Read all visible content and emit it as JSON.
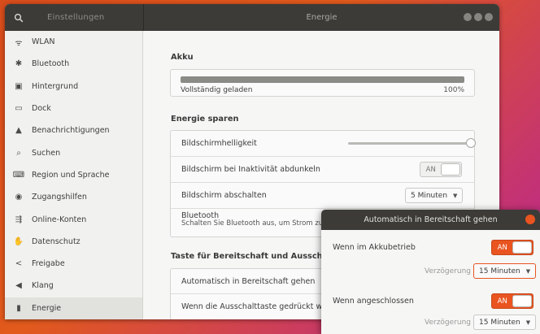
{
  "header": {
    "search_icon": "search-icon",
    "left_title": "Einstellungen",
    "title": "Energie"
  },
  "sidebar": {
    "items": [
      {
        "label": "WLAN",
        "icon": "wifi-icon",
        "glyph": "ᯤ"
      },
      {
        "label": "Bluetooth",
        "icon": "bluetooth-icon",
        "glyph": "✱"
      },
      {
        "label": "Hintergrund",
        "icon": "background-icon",
        "glyph": "▣"
      },
      {
        "label": "Dock",
        "icon": "dock-icon",
        "glyph": "▭"
      },
      {
        "label": "Benachrichtigungen",
        "icon": "bell-icon",
        "glyph": "▲"
      },
      {
        "label": "Suchen",
        "icon": "search-icon",
        "glyph": "⌕"
      },
      {
        "label": "Region und Sprache",
        "icon": "keyboard-icon",
        "glyph": "⌨"
      },
      {
        "label": "Zugangshilfen",
        "icon": "accessibility-icon",
        "glyph": "◉"
      },
      {
        "label": "Online-Konten",
        "icon": "online-accounts-icon",
        "glyph": "⇶"
      },
      {
        "label": "Datenschutz",
        "icon": "privacy-icon",
        "glyph": "✋"
      },
      {
        "label": "Freigabe",
        "icon": "share-icon",
        "glyph": "<"
      },
      {
        "label": "Klang",
        "icon": "speaker-icon",
        "glyph": "◀"
      },
      {
        "label": "Energie",
        "icon": "power-icon",
        "glyph": "▮"
      }
    ],
    "active_index": 12
  },
  "battery": {
    "section_title": "Akku",
    "status": "Vollständig geladen",
    "percent_text": "100%",
    "level": 1.0
  },
  "power_saving": {
    "section_title": "Energie sparen",
    "brightness_label": "Bildschirmhelligkeit",
    "brightness_level": 0.97,
    "dim_label": "Bildschirm bei Inaktivität abdunkeln",
    "dim_switch_label": "AN",
    "blank_label": "Bildschirm abschalten",
    "blank_value": "5 Minuten",
    "bluetooth_label": "Bluetooth",
    "bluetooth_sub": "Schalten Sie Bluetooth aus, um Strom zu"
  },
  "suspend": {
    "section_title": "Taste für Bereitschaft und Ausschalten",
    "auto_suspend_label": "Automatisch in Bereitschaft gehen",
    "power_button_label": "Wenn die Ausschalttaste gedrückt wird"
  },
  "dialog": {
    "title": "Automatisch in Bereitschaft gehen",
    "battery_label": "Wenn im Akkubetrieb",
    "battery_switch": "AN",
    "battery_delay_label": "Verzögerung",
    "battery_delay_value": "15 Minuten",
    "plugged_label": "Wenn angeschlossen",
    "plugged_switch": "AN",
    "plugged_delay_label": "Verzögerung",
    "plugged_delay_value": "15 Minuten"
  },
  "colors": {
    "accent": "#e95420",
    "headerbar": "#3c3b37"
  }
}
